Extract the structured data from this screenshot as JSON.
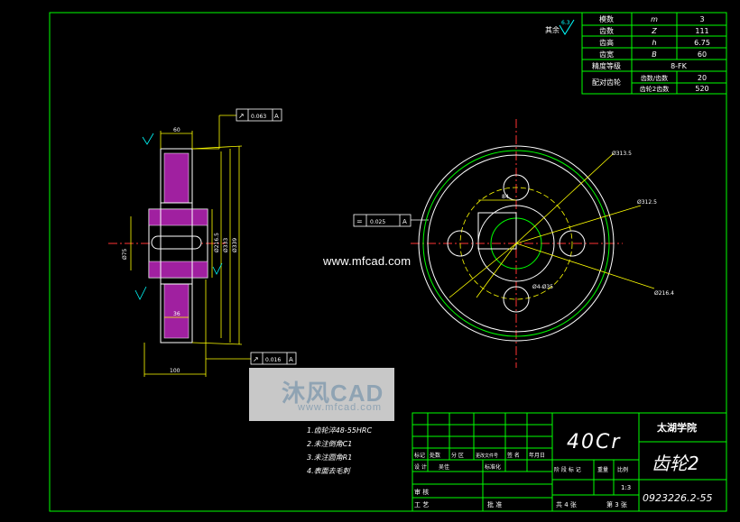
{
  "roughness_note": "其余",
  "roughness_value": "6.3",
  "params_table": [
    {
      "name": "模数",
      "symbol": "m",
      "value": "3"
    },
    {
      "name": "齿数",
      "symbol": "Z",
      "value": "111"
    },
    {
      "name": "齿高",
      "symbol": "h",
      "value": "6.75"
    },
    {
      "name": "齿宽",
      "symbol": "B",
      "value": "60"
    },
    {
      "name": "精度等级",
      "symbol": "",
      "value": "8-FK"
    },
    {
      "name": "配对齿轮",
      "symbol": "齿数/齿数",
      "value": "20"
    },
    {
      "name": "",
      "symbol": "齿轮2齿数",
      "value": "520"
    }
  ],
  "tolerance_top": {
    "symbol": "↗",
    "value": "0.063",
    "datum": "A"
  },
  "tolerance_mid": {
    "symbol": "=",
    "value": "0.025",
    "datum": "A"
  },
  "tolerance_bottom": {
    "symbol": "↗",
    "value": "0.016",
    "datum": "A"
  },
  "dimensions": {
    "top_width": "60",
    "bottom_width": "100",
    "hub_len": "36",
    "bore": "Ø75",
    "d1": "Ø216.5",
    "d2": "Ø333",
    "d3": "Ø339",
    "plan_d1": "Ø313.5",
    "plan_d2": "Ø312.5",
    "plan_d3": "Ø216.4",
    "plan_d4": "Ø4-Ø35",
    "plan_key": "84"
  },
  "notes": [
    "1.齿轮淬48-55HRC",
    "2.未注倒角C1",
    "3.未注圆角R1",
    "4.表面去毛刺"
  ],
  "title_block": {
    "material": "40Cr",
    "school": "太湖学院",
    "part_name": "齿轮2",
    "drawing_no": "0923226.2-55",
    "scale": "1:3",
    "sheets_total": "共 4 张",
    "sheet_no": "第 3 张",
    "header_row": [
      "标记",
      "处数",
      "分 区",
      "更改文件号",
      "签 名",
      "年月日"
    ],
    "design_row": [
      "设 计",
      "吴佳",
      "",
      "标准化",
      ""
    ],
    "stage_labels": [
      "阶 段 标 记",
      "重量",
      "比例"
    ],
    "review_label": "审 核",
    "process_label": "工 艺",
    "approve_label": "批 准"
  },
  "watermark": {
    "site": "www.mfcad.com",
    "brand": "沐风CAD",
    "domain": "www.mfcad.com"
  }
}
